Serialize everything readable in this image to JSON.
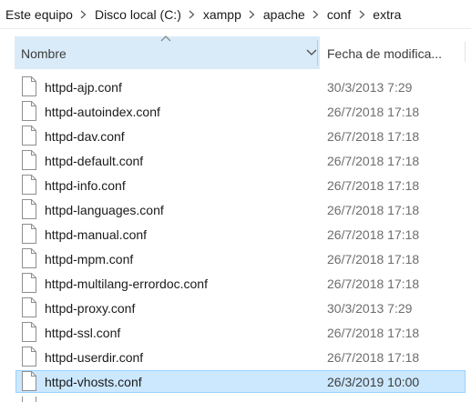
{
  "breadcrumb": {
    "items": [
      "Este equipo",
      "Disco local (C:)",
      "xampp",
      "apache",
      "conf",
      "extra"
    ],
    "separator_icon": "chevron-right-icon"
  },
  "columns": {
    "name_label": "Nombre",
    "date_label": "Fecha de modifica...",
    "sort_icon": "chevron-up-icon",
    "dropdown_icon": "chevron-down-icon"
  },
  "files": [
    {
      "name": "httpd-ajp.conf",
      "date": "30/3/2013 7:29"
    },
    {
      "name": "httpd-autoindex.conf",
      "date": "26/7/2018 17:18"
    },
    {
      "name": "httpd-dav.conf",
      "date": "26/7/2018 17:18"
    },
    {
      "name": "httpd-default.conf",
      "date": "26/7/2018 17:18"
    },
    {
      "name": "httpd-info.conf",
      "date": "26/7/2018 17:18"
    },
    {
      "name": "httpd-languages.conf",
      "date": "26/7/2018 17:18"
    },
    {
      "name": "httpd-manual.conf",
      "date": "26/7/2018 17:18"
    },
    {
      "name": "httpd-mpm.conf",
      "date": "26/7/2018 17:18"
    },
    {
      "name": "httpd-multilang-errordoc.conf",
      "date": "26/7/2018 17:18"
    },
    {
      "name": "httpd-proxy.conf",
      "date": "30/3/2013 7:29"
    },
    {
      "name": "httpd-ssl.conf",
      "date": "26/7/2018 17:18"
    },
    {
      "name": "httpd-userdir.conf",
      "date": "26/7/2018 17:18"
    },
    {
      "name": "httpd-vhosts.conf",
      "date": "26/3/2019 10:00",
      "selected": true
    }
  ],
  "icons": {
    "file": "file-icon"
  },
  "colors": {
    "selection_bg": "#cce8ff",
    "selection_border": "#99d1ff",
    "header_hover_bg": "#d9ebf9"
  }
}
